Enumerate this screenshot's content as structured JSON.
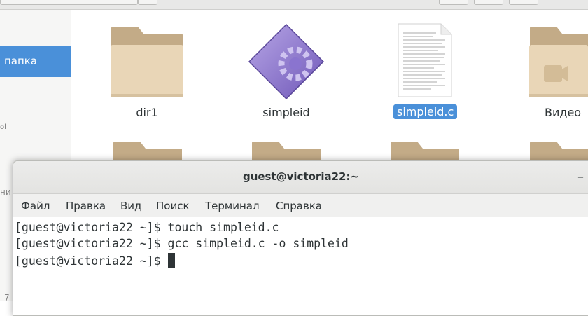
{
  "file_manager": {
    "sidebar": {
      "selected_label": "папка",
      "fragment_1": "ol",
      "fragment_2": "ни",
      "fragment_3": "7"
    },
    "items": [
      {
        "label": "dir1",
        "icon": "folder-icon"
      },
      {
        "label": "simpleid",
        "icon": "executable-icon"
      },
      {
        "label": "simpleid.c",
        "icon": "text-document-icon",
        "selected": true
      },
      {
        "label": "Видео",
        "icon": "video-folder-icon"
      }
    ],
    "colors": {
      "selection": "#4a90d9",
      "folder": "#e7d4b5",
      "folder_tab": "#c7b08c"
    }
  },
  "terminal": {
    "title": "guest@victoria22:~",
    "minimize_symbol": "–",
    "menu": [
      "Файл",
      "Правка",
      "Вид",
      "Поиск",
      "Терминал",
      "Справка"
    ],
    "lines": [
      "[guest@victoria22 ~]$ touch simpleid.c",
      "[guest@victoria22 ~]$ gcc simpleid.c -o simpleid",
      "[guest@victoria22 ~]$ "
    ]
  }
}
